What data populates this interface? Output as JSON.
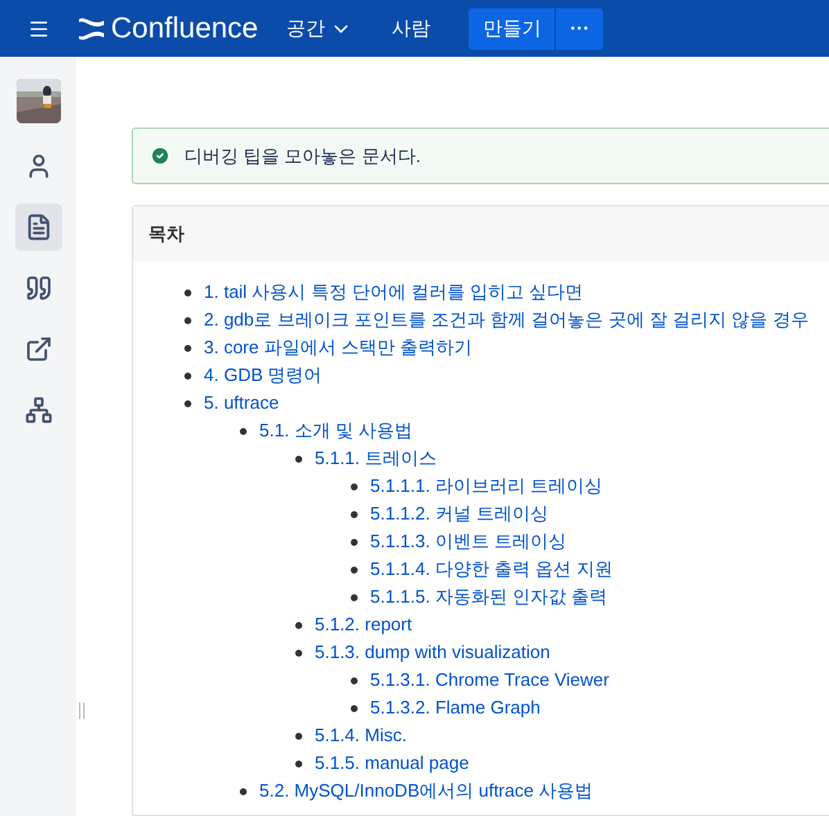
{
  "topbar": {
    "logo": "Confluence",
    "nav": [
      {
        "label": "공간",
        "dropdown": true
      },
      {
        "label": "사람",
        "dropdown": false
      }
    ],
    "create": "만들기",
    "more": "···"
  },
  "sidebar": {
    "items": [
      {
        "kind": "person",
        "selected": false
      },
      {
        "kind": "page",
        "selected": true
      },
      {
        "kind": "quote",
        "selected": false
      },
      {
        "kind": "export",
        "selected": false
      },
      {
        "kind": "tree",
        "selected": false
      }
    ]
  },
  "info": {
    "text": "디버깅 팁을 모아놓은 문서다."
  },
  "toc": {
    "title": "목차",
    "items": [
      {
        "label": "1. tail 사용시 특정 단어에 컬러를 입히고 싶다면"
      },
      {
        "label": "2. gdb로 브레이크 포인트를 조건과 함께 걸어놓은 곳에 잘 걸리지 않을 경우"
      },
      {
        "label": "3. core 파일에서 스택만 출력하기"
      },
      {
        "label": "4. GDB 명령어"
      },
      {
        "label": "5. uftrace",
        "children": [
          {
            "label": "5.1. 소개 및 사용법",
            "children": [
              {
                "label": "5.1.1. 트레이스",
                "children": [
                  {
                    "label": "5.1.1.1. 라이브러리 트레이싱"
                  },
                  {
                    "label": "5.1.1.2. 커널 트레이싱"
                  },
                  {
                    "label": "5.1.1.3. 이벤트 트레이싱"
                  },
                  {
                    "label": "5.1.1.4. 다양한 출력 옵션 지원"
                  },
                  {
                    "label": "5.1.1.5. 자동화된 인자값 출력"
                  }
                ]
              },
              {
                "label": "5.1.2. report"
              },
              {
                "label": "5.1.3. dump with visualization",
                "children": [
                  {
                    "label": "5.1.3.1. Chrome Trace Viewer"
                  },
                  {
                    "label": "5.1.3.2. Flame Graph"
                  }
                ]
              },
              {
                "label": "5.1.4. Misc."
              },
              {
                "label": "5.1.5. manual page"
              }
            ]
          },
          {
            "label": "5.2. MySQL/InnoDB에서의 uftrace 사용법"
          }
        ]
      }
    ]
  }
}
